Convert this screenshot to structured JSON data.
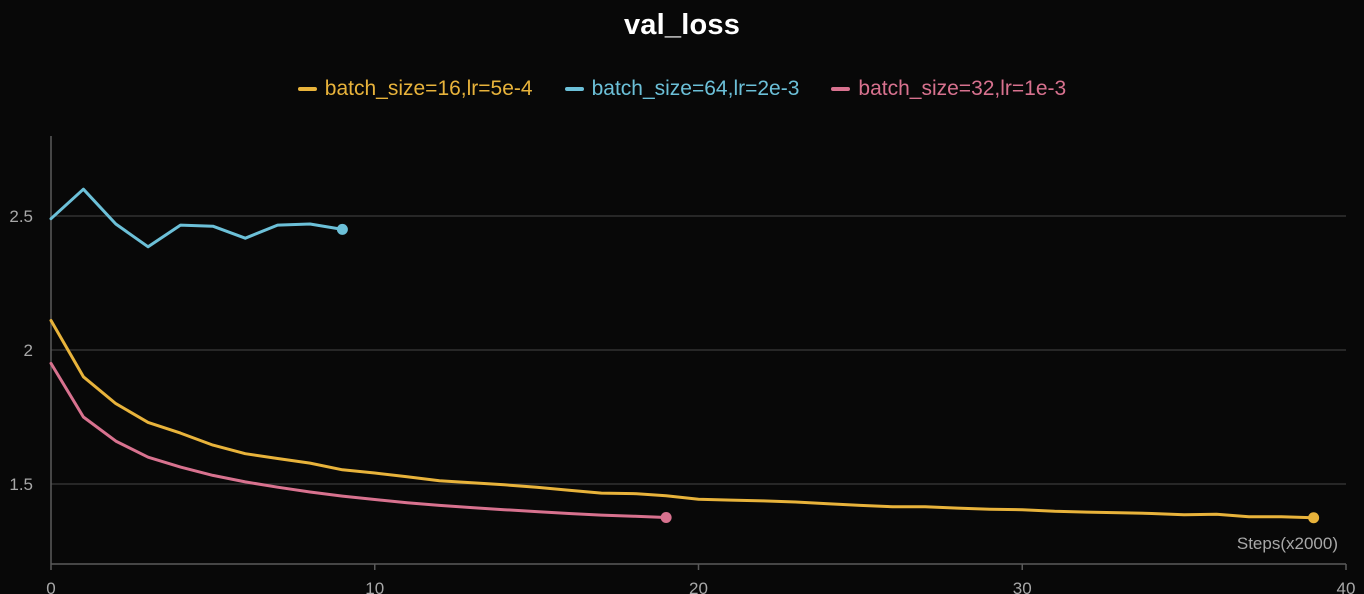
{
  "chart_data": {
    "type": "line",
    "title": "val_loss",
    "xlabel": "Steps(x2000)",
    "ylabel": "",
    "xlim": [
      0,
      40
    ],
    "ylim": [
      1.3,
      2.8
    ],
    "xticks": [
      0,
      10,
      20,
      30,
      40
    ],
    "yticks": [
      1.5,
      2,
      2.5
    ],
    "ytick_labels": [
      "1.5",
      "2",
      "2.5"
    ],
    "grid": "horizontal",
    "legend_position": "top-center",
    "series": [
      {
        "name": "batch_size=16,lr=5e-4",
        "color": "#e8b33b",
        "x": [
          0,
          1,
          2,
          3,
          4,
          5,
          6,
          7,
          8,
          9,
          10,
          11,
          12,
          13,
          14,
          15,
          16,
          17,
          18,
          19,
          20,
          21,
          22,
          23,
          24,
          25,
          26,
          27,
          28,
          29,
          30,
          31,
          32,
          33,
          34,
          35,
          36,
          37,
          38,
          39
        ],
        "y": [
          2.11,
          1.9,
          1.8,
          1.73,
          1.69,
          1.645,
          1.613,
          1.595,
          1.578,
          1.553,
          1.541,
          1.527,
          1.512,
          1.505,
          1.497,
          1.488,
          1.477,
          1.466,
          1.464,
          1.456,
          1.443,
          1.44,
          1.437,
          1.433,
          1.426,
          1.42,
          1.415,
          1.415,
          1.41,
          1.406,
          1.404,
          1.398,
          1.395,
          1.393,
          1.39,
          1.385,
          1.387,
          1.378,
          1.378,
          1.374
        ]
      },
      {
        "name": "batch_size=64,lr=2e-3",
        "color": "#6cc0d8",
        "x": [
          0,
          1,
          2,
          3,
          4,
          5,
          6,
          7,
          8,
          9
        ],
        "y": [
          2.49,
          2.6,
          2.47,
          2.385,
          2.466,
          2.462,
          2.417,
          2.466,
          2.47,
          2.45
        ]
      },
      {
        "name": "batch_size=32,lr=1e-3",
        "color": "#d8728f",
        "x": [
          0,
          1,
          2,
          3,
          4,
          5,
          6,
          7,
          8,
          9,
          10,
          11,
          12,
          13,
          14,
          15,
          16,
          17,
          18,
          19
        ],
        "y": [
          1.95,
          1.75,
          1.66,
          1.6,
          1.563,
          1.532,
          1.508,
          1.488,
          1.47,
          1.455,
          1.442,
          1.43,
          1.42,
          1.412,
          1.404,
          1.397,
          1.39,
          1.384,
          1.38,
          1.375
        ]
      }
    ]
  }
}
